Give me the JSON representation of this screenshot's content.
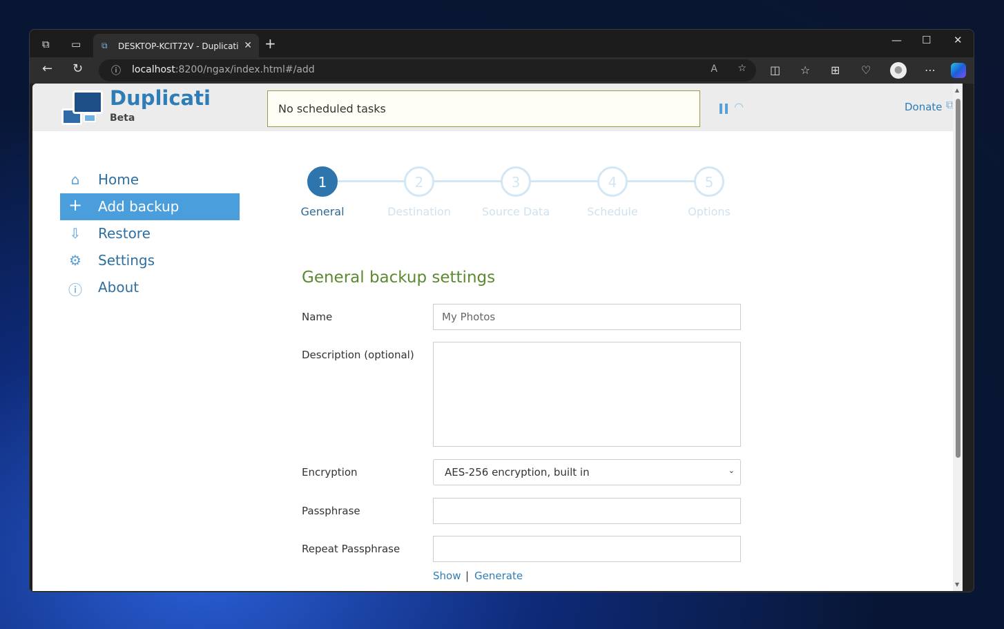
{
  "browser": {
    "tab_title": "DESKTOP-KCIT72V - Duplicati",
    "url_host": "localhost",
    "url_path": ":8200/ngax/index.html#/add"
  },
  "header": {
    "brand": "Duplicati",
    "sub": "Beta",
    "status": "No scheduled tasks",
    "donate": "Donate"
  },
  "sidebar": {
    "items": [
      {
        "label": "Home",
        "icon": "home-icon"
      },
      {
        "label": "Add backup",
        "icon": "plus-icon",
        "active": true
      },
      {
        "label": "Restore",
        "icon": "restore-icon"
      },
      {
        "label": "Settings",
        "icon": "gear-icon"
      },
      {
        "label": "About",
        "icon": "info-icon"
      }
    ]
  },
  "steps": [
    {
      "num": "1",
      "label": "General",
      "active": true
    },
    {
      "num": "2",
      "label": "Destination"
    },
    {
      "num": "3",
      "label": "Source Data"
    },
    {
      "num": "4",
      "label": "Schedule"
    },
    {
      "num": "5",
      "label": "Options"
    }
  ],
  "form": {
    "title": "General backup settings",
    "name_label": "Name",
    "name_placeholder": "My Photos",
    "desc_label": "Description (optional)",
    "enc_label": "Encryption",
    "enc_value": "AES-256 encryption, built in",
    "pass_label": "Passphrase",
    "repeat_label": "Repeat Passphrase",
    "show": "Show",
    "sep": "|",
    "generate": "Generate"
  },
  "colors": {
    "accent": "#4a9edc",
    "brand": "#2e7db6",
    "heading": "#5b8a2e"
  }
}
